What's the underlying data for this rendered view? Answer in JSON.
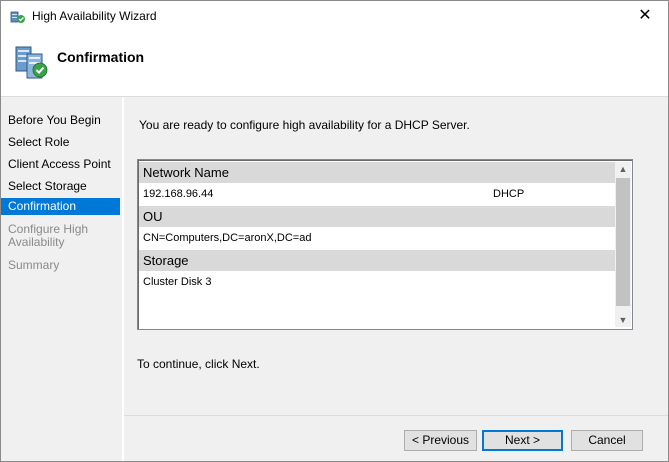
{
  "window": {
    "title": "High Availability Wizard",
    "close_glyph": "✕"
  },
  "header": {
    "title": "Confirmation"
  },
  "steps": [
    {
      "label": "Before You Begin",
      "state": "normal"
    },
    {
      "label": "Select Role",
      "state": "normal"
    },
    {
      "label": "Client Access Point",
      "state": "normal"
    },
    {
      "label": "Select Storage",
      "state": "normal"
    },
    {
      "label": "Confirmation",
      "state": "active"
    },
    {
      "label": "Configure High Availability",
      "state": "disabled"
    },
    {
      "label": "Summary",
      "state": "disabled"
    }
  ],
  "main": {
    "intro": "You are ready to configure high availability for a DHCP Server.",
    "groups": [
      {
        "header": "Network Name",
        "value": "192.168.96.44",
        "value2": "DHCP"
      },
      {
        "header": "OU",
        "value": "CN=Computers,DC=aronX,DC=ad"
      },
      {
        "header": "Storage",
        "value": "Cluster Disk 3"
      }
    ],
    "continue_text": "To continue, click Next."
  },
  "buttons": {
    "previous": "< Previous",
    "next": "Next >",
    "cancel": "Cancel"
  },
  "scrollbar": {
    "up": "▲",
    "down": "▼"
  },
  "colors": {
    "accent": "#0078d7",
    "sidebar_bg": "#f0f0f0",
    "group_header_bg": "#d9d9d9"
  }
}
